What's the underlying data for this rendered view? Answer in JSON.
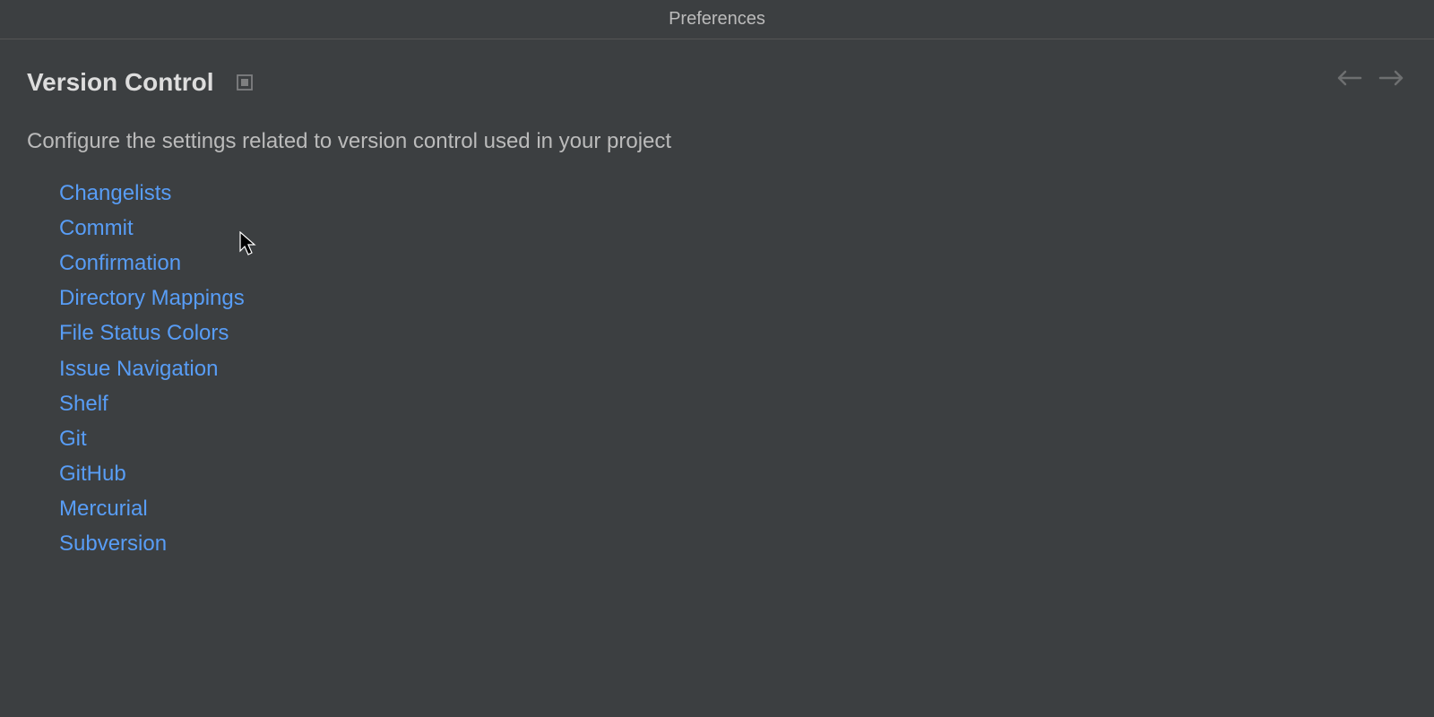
{
  "window": {
    "title": "Preferences"
  },
  "header": {
    "section_title": "Version Control"
  },
  "description": "Configure the settings related to version control used in your project",
  "links": [
    "Changelists",
    "Commit",
    "Confirmation",
    "Directory Mappings",
    "File Status Colors",
    "Issue Navigation",
    "Shelf",
    "Git",
    "GitHub",
    "Mercurial",
    "Subversion"
  ]
}
